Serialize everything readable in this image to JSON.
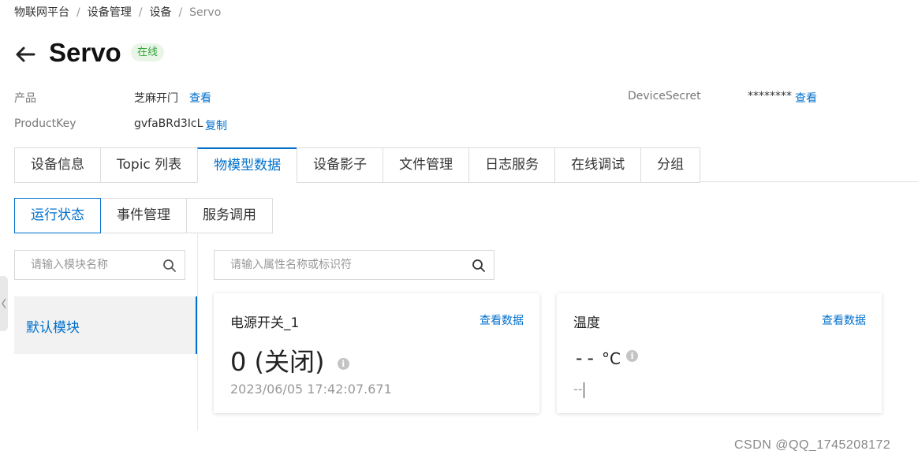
{
  "breadcrumb": [
    "物联网平台",
    "设备管理",
    "设备",
    "Servo"
  ],
  "header": {
    "title": "Servo",
    "status": "在线"
  },
  "info": {
    "product_label": "产品",
    "product_value": "芝麻开门",
    "product_action": "查看",
    "productkey_label": "ProductKey",
    "productkey_value": "gvfaBRd3IcL",
    "productkey_action": "复制",
    "secret_label": "DeviceSecret",
    "secret_value": "********",
    "secret_action": "查看"
  },
  "tabs": [
    "设备信息",
    "Topic 列表",
    "物模型数据",
    "设备影子",
    "文件管理",
    "日志服务",
    "在线调试",
    "分组"
  ],
  "active_tab": "物模型数据",
  "subtabs": [
    "运行状态",
    "事件管理",
    "服务调用"
  ],
  "active_subtab": "运行状态",
  "module_search": {
    "placeholder": "请输入模块名称"
  },
  "property_search": {
    "placeholder": "请输入属性名称或标识符"
  },
  "modules": [
    "默认模块"
  ],
  "cards": [
    {
      "title": "电源开关_1",
      "action": "查看数据",
      "value": "0 (关闭)",
      "unit": "",
      "time": "2023/06/05 17:42:07.671"
    },
    {
      "title": "温度",
      "action": "查看数据",
      "value": "--",
      "unit": "°C",
      "time": "--"
    }
  ],
  "watermark": "CSDN @QQ_1745208172",
  "colors": {
    "accent": "#0070cc",
    "status_bg": "#e9f6e7",
    "status_text": "#36a43a"
  }
}
